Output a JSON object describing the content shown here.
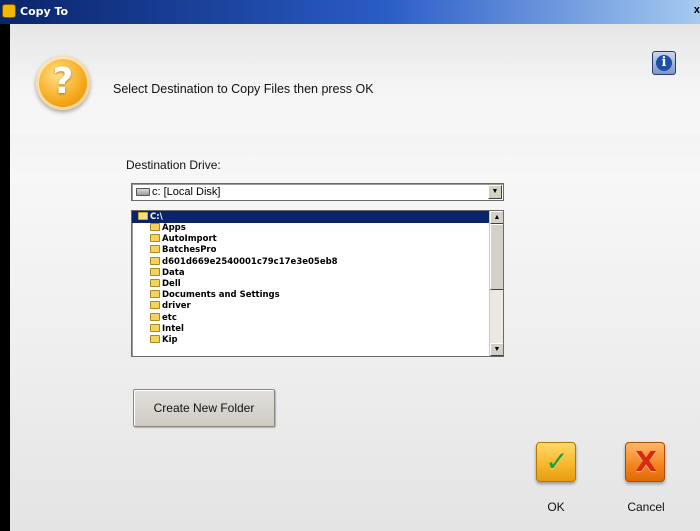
{
  "window": {
    "title": "Copy To",
    "close_glyph": "x"
  },
  "header": {
    "question_icon": "question-icon",
    "question_glyph": "?",
    "instruction": "Select Destination to Copy Files then press OK",
    "info_icon": "info-icon",
    "info_glyph": "i"
  },
  "destination": {
    "label": "Destination Drive:",
    "drive_value": "c: [Local Disk]",
    "drive_icon": "hard-disk-icon",
    "dropdown_arrow": "▼"
  },
  "folders": {
    "root": "C:\\",
    "items": [
      "Apps",
      "AutoImport",
      "BatchesPro",
      "d601d669e2540001c79c17e3e05eb8",
      "Data",
      "Dell",
      "Documents and Settings",
      "driver",
      "etc",
      "Intel",
      "Kip"
    ],
    "scroll_up": "▲",
    "scroll_down": "▼"
  },
  "buttons": {
    "create_folder": "Create New Folder",
    "ok_label": "OK",
    "ok_glyph": "✓",
    "cancel_label": "Cancel",
    "cancel_glyph": "X"
  },
  "colors": {
    "title_bar": "#0a246a",
    "selection": "#0a246a",
    "ok_button": "#f7b52a",
    "cancel_button": "#f2841e"
  }
}
